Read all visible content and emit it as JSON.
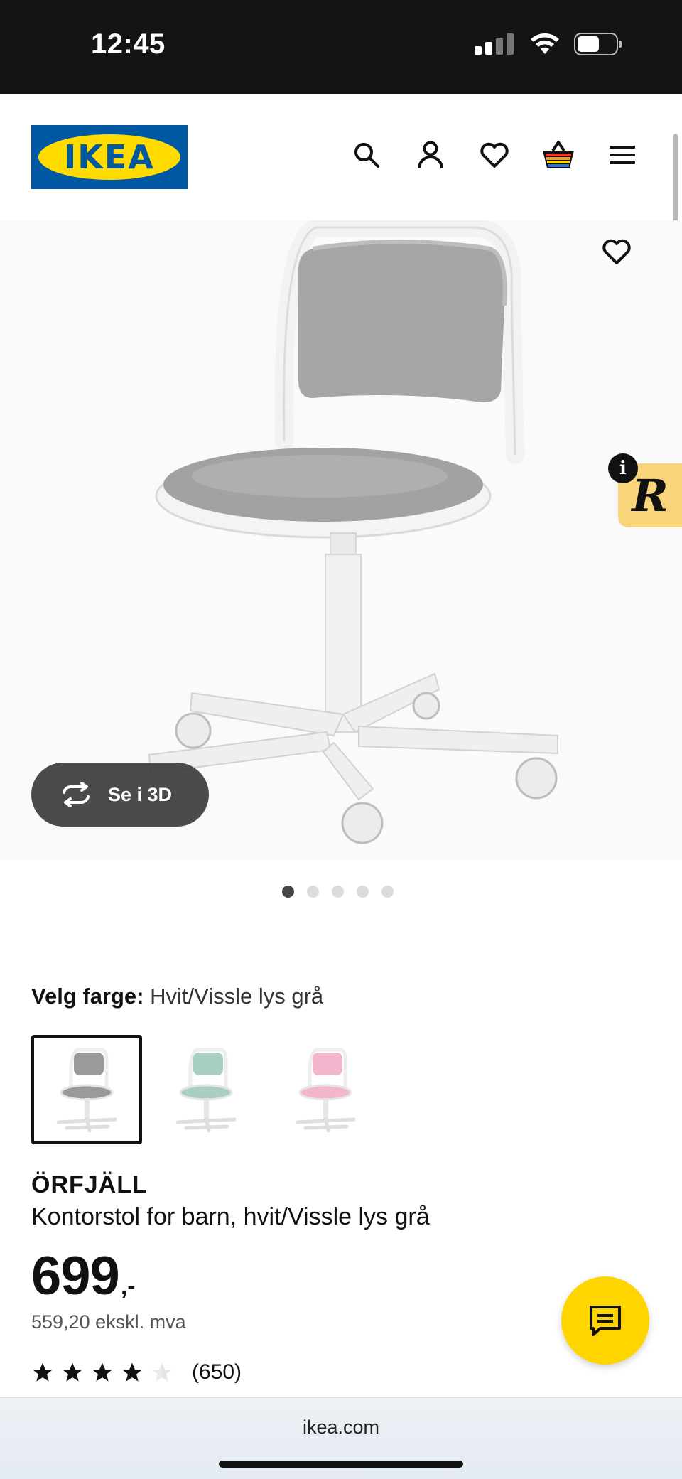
{
  "status_bar": {
    "time": "12:45",
    "icons": [
      "cellular-signal-icon",
      "wifi-icon",
      "battery-icon"
    ]
  },
  "header": {
    "logo_text": "IKEA",
    "brand_colors": {
      "blue": "#0058a3",
      "yellow": "#ffdb00"
    },
    "actions": [
      "search-icon",
      "account-icon",
      "wishlist-heart-icon",
      "shopping-bag-icon",
      "menu-icon"
    ]
  },
  "gallery": {
    "view_3d_label": "Se i 3D",
    "badge_letter": "R",
    "badge_info": "i",
    "slide_count": 5,
    "active_slide": 1
  },
  "color_picker": {
    "label": "Velg farge:",
    "selected_value": "Hvit/Vissle lys grå",
    "swatches": [
      {
        "name": "gray",
        "color": "#9a9a9a",
        "selected": true
      },
      {
        "name": "green",
        "color": "#a9cfc0",
        "selected": false
      },
      {
        "name": "pink",
        "color": "#f3b6cf",
        "selected": false
      }
    ]
  },
  "product": {
    "name": "ÖRFJÄLL",
    "description": "Kontorstol for barn, hvit/Vissle lys grå",
    "price": "699",
    "price_suffix": ",-",
    "price_ex_vat": "559,20 ekskl. mva",
    "rating_stars": 4,
    "rating_max": 5,
    "review_count": "(650)"
  },
  "browser": {
    "url": "ikea.com"
  }
}
